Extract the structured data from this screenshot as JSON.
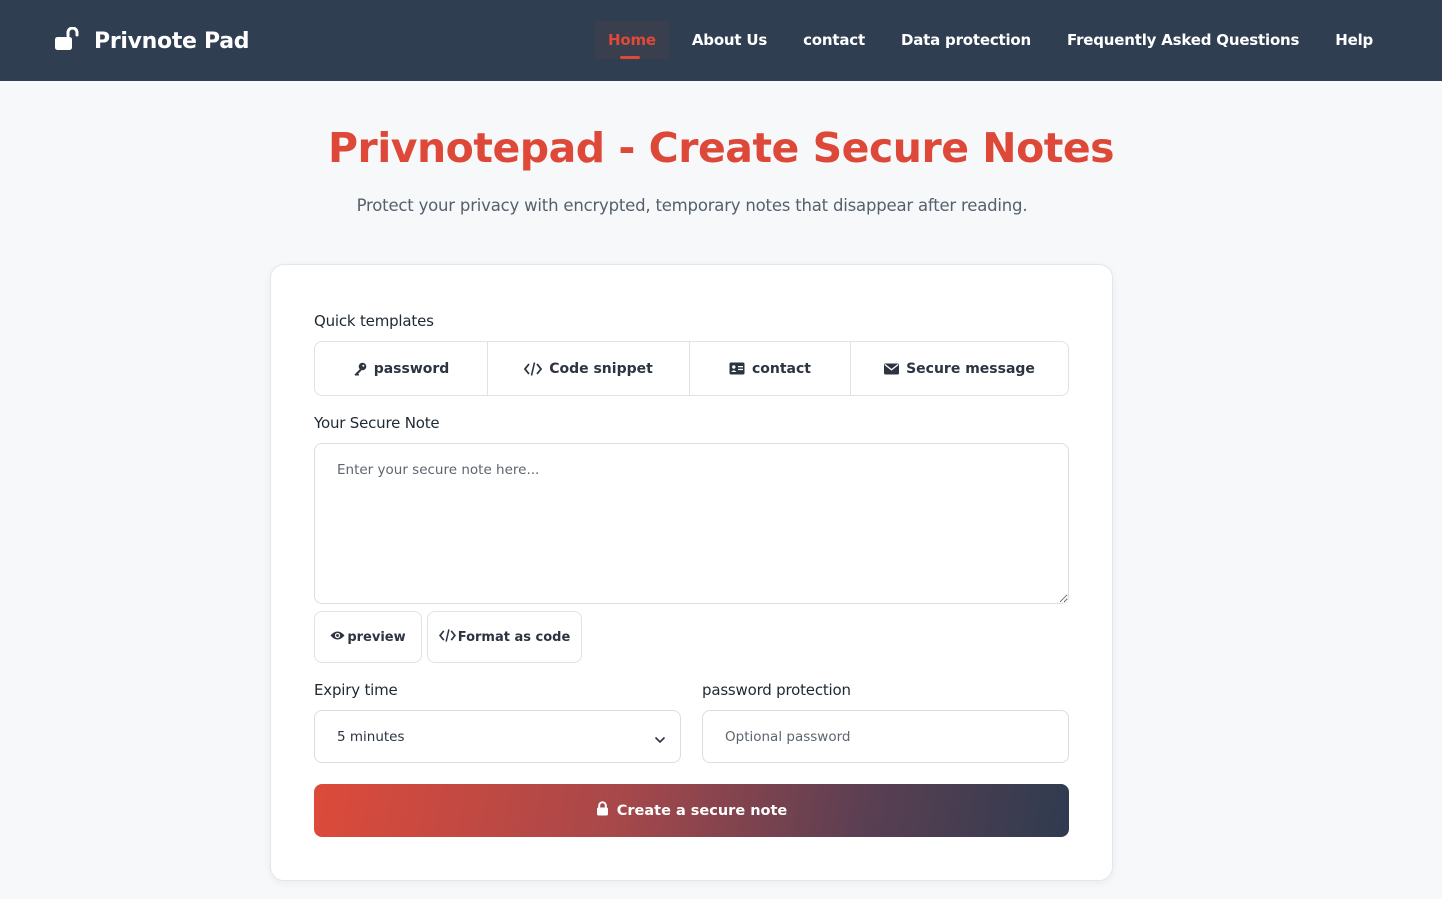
{
  "header": {
    "brand": "Privnote Pad",
    "nav": [
      {
        "label": "Home",
        "active": true
      },
      {
        "label": "About Us",
        "active": false
      },
      {
        "label": "contact",
        "active": false
      },
      {
        "label": "Data protection",
        "active": false
      },
      {
        "label": "Frequently Asked Questions",
        "active": false
      },
      {
        "label": "Help",
        "active": false
      }
    ]
  },
  "hero": {
    "title": "Privnotepad - Create Secure Notes",
    "subtitle": "Protect your privacy with encrypted, temporary notes that disappear after reading."
  },
  "form": {
    "templates_label": "Quick templates",
    "templates": [
      {
        "label": "password",
        "icon": "key-icon"
      },
      {
        "label": "Code snippet",
        "icon": "code-icon"
      },
      {
        "label": "contact",
        "icon": "id-card-icon"
      },
      {
        "label": "Secure message",
        "icon": "envelope-icon"
      }
    ],
    "note_label": "Your Secure Note",
    "note_placeholder": "Enter your secure note here...",
    "preview_label": "preview",
    "format_label": "Format as code",
    "expiry_label": "Expiry time",
    "expiry_value": "5 minutes",
    "password_label": "password protection",
    "password_placeholder": "Optional password",
    "submit_label": "Create a secure note"
  },
  "colors": {
    "header_bg": "#2f3e50",
    "accent": "#dd4838",
    "page_bg": "#f6f8fa"
  }
}
